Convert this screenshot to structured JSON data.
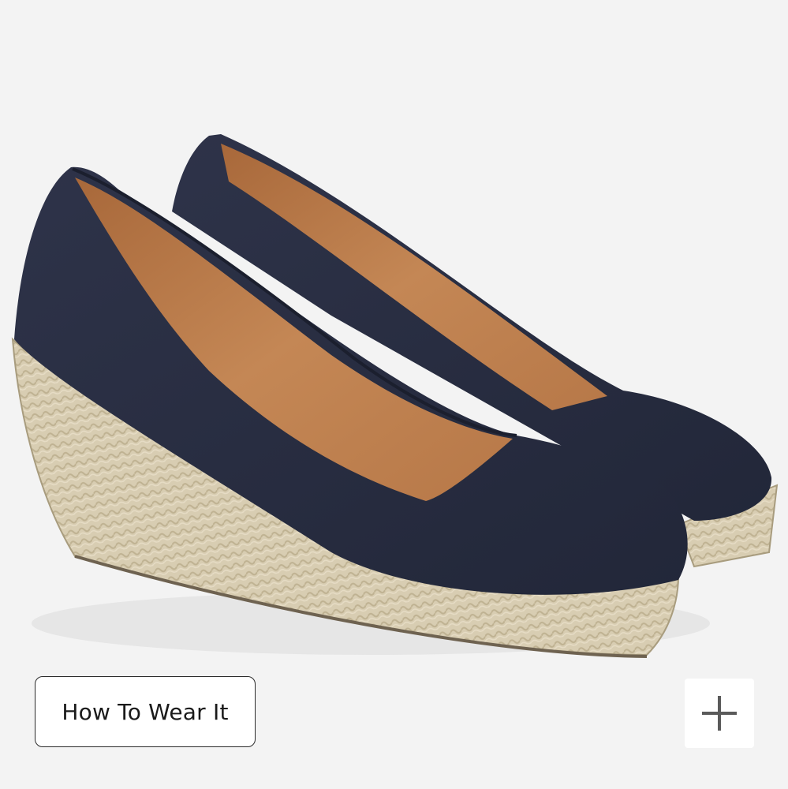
{
  "product_image": {
    "alt_name": "navy-espadrille-wedge-shoes"
  },
  "buttons": {
    "how_to_wear": "How To Wear It"
  },
  "icons": {
    "plus": "plus-icon"
  },
  "colors": {
    "background": "#f3f3f3",
    "canvas": "#2a2f44",
    "lining": "#b97a4a",
    "jute": "#d6cbb0",
    "button_border": "#2b2b2b"
  }
}
